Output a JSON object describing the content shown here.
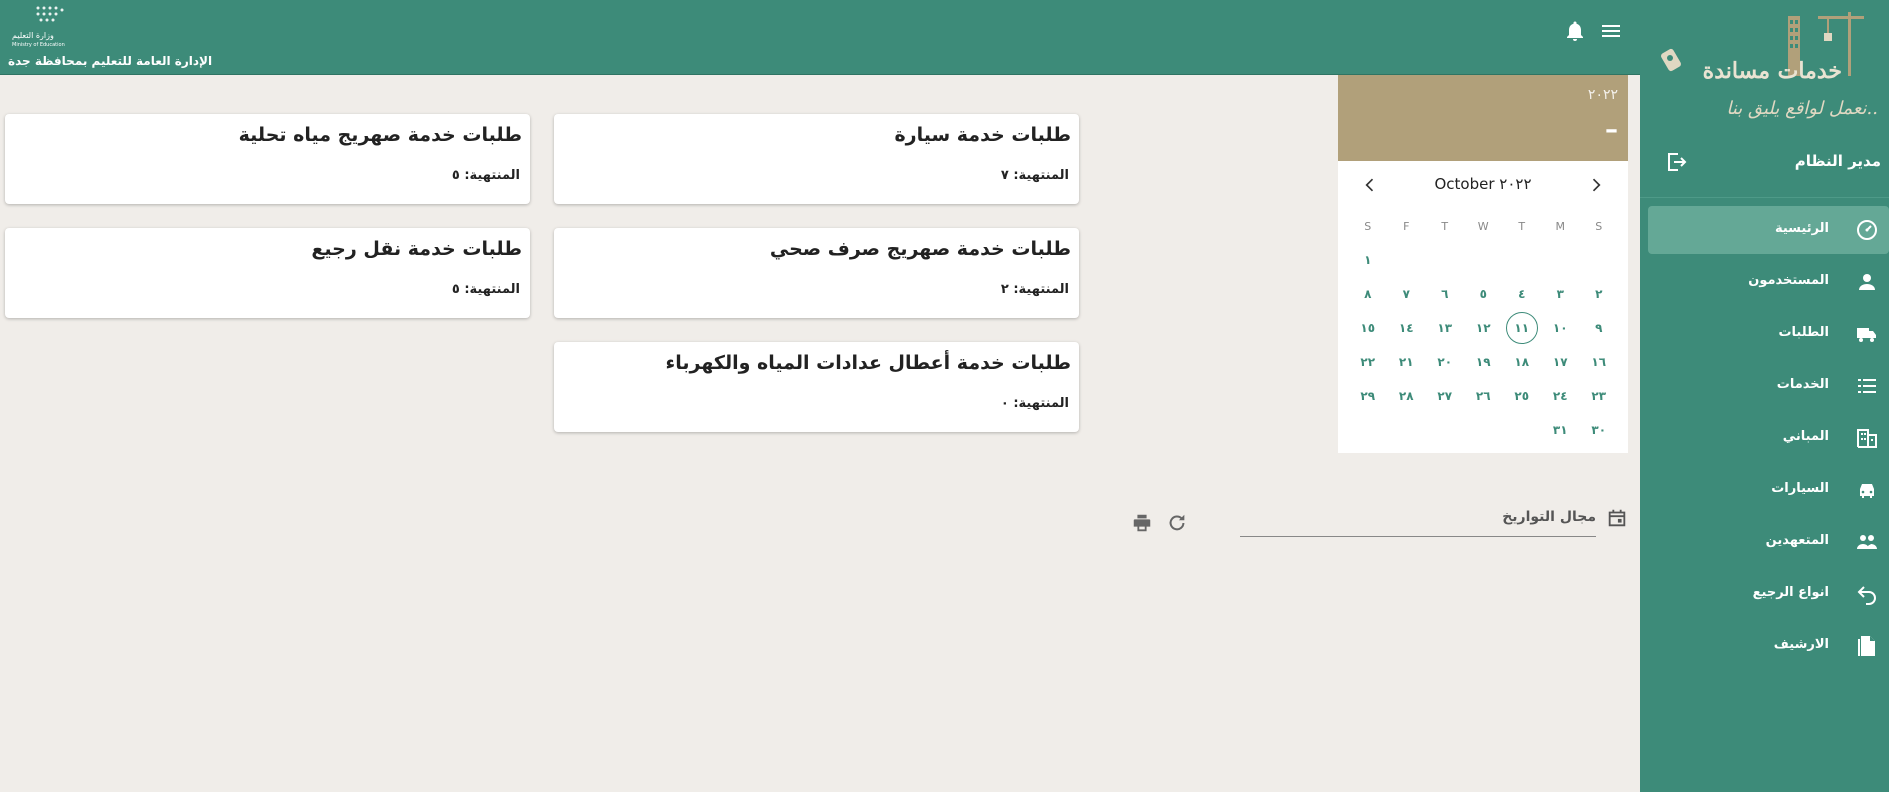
{
  "header": {
    "department": "الإدارة العامة للتعليم بمحافظة جدة",
    "ministry_logo_text": "وزارة التعليم",
    "ministry_logo_subtext": "Ministry of Education"
  },
  "brand": {
    "name": "خدمات مساندة",
    "slogan": "نعمل لواقع يليق بنا.."
  },
  "user": {
    "name": "مدير النظام"
  },
  "nav": {
    "items": [
      {
        "label": "الرئيسية",
        "icon": "dashboard-icon",
        "active": true
      },
      {
        "label": "المستخدمون",
        "icon": "person-icon"
      },
      {
        "label": "الطلبات",
        "icon": "truck-icon"
      },
      {
        "label": "الخدمات",
        "icon": "list-icon"
      },
      {
        "label": "المباني",
        "icon": "building-icon"
      },
      {
        "label": "السيارات",
        "icon": "car-icon"
      },
      {
        "label": "المتعهدين",
        "icon": "people-icon"
      },
      {
        "label": "انواع الرجيع",
        "icon": "undo-icon"
      },
      {
        "label": "الارشيف",
        "icon": "file-icon"
      }
    ]
  },
  "calendar": {
    "year": "٢٠٢٢",
    "selected_display": "–",
    "month_label": "October ٢٠٢٢",
    "weekdays": [
      "S",
      "M",
      "T",
      "W",
      "T",
      "F",
      "S"
    ],
    "weeks": [
      [
        "",
        "",
        "",
        "",
        "",
        "",
        "١"
      ],
      [
        "٢",
        "٣",
        "٤",
        "٥",
        "٦",
        "٧",
        "٨"
      ],
      [
        "٩",
        "١٠",
        "١١",
        "١٢",
        "١٣",
        "١٤",
        "١٥"
      ],
      [
        "١٦",
        "١٧",
        "١٨",
        "١٩",
        "٢٠",
        "٢١",
        "٢٢"
      ],
      [
        "٢٣",
        "٢٤",
        "٢٥",
        "٢٦",
        "٢٧",
        "٢٨",
        "٢٩"
      ],
      [
        "٣٠",
        "٣١",
        "",
        "",
        "",
        "",
        ""
      ]
    ],
    "today": "١١"
  },
  "cards": [
    {
      "title": "طلبات خدمة سيارة",
      "count": "المنتهية: ٧"
    },
    {
      "title": "طلبات خدمة صهريج مياه تحلية",
      "count": "المنتهية: ٥"
    },
    {
      "title": "طلبات خدمة صهريج صرف صحي",
      "count": "المنتهية: ٢"
    },
    {
      "title": "طلبات خدمة نقل رجيع",
      "count": "المنتهية: ٥"
    },
    {
      "title": "طلبات خدمة أعطال عدادات المياه والكهرباء",
      "count": "المنتهية: ٠"
    }
  ],
  "date_range": {
    "label": "مجال التواريخ"
  },
  "colors": {
    "primary": "#3d8b79",
    "active_nav": "#64a896",
    "calendar_header": "#b1a07a",
    "background": "#f0ede9"
  }
}
